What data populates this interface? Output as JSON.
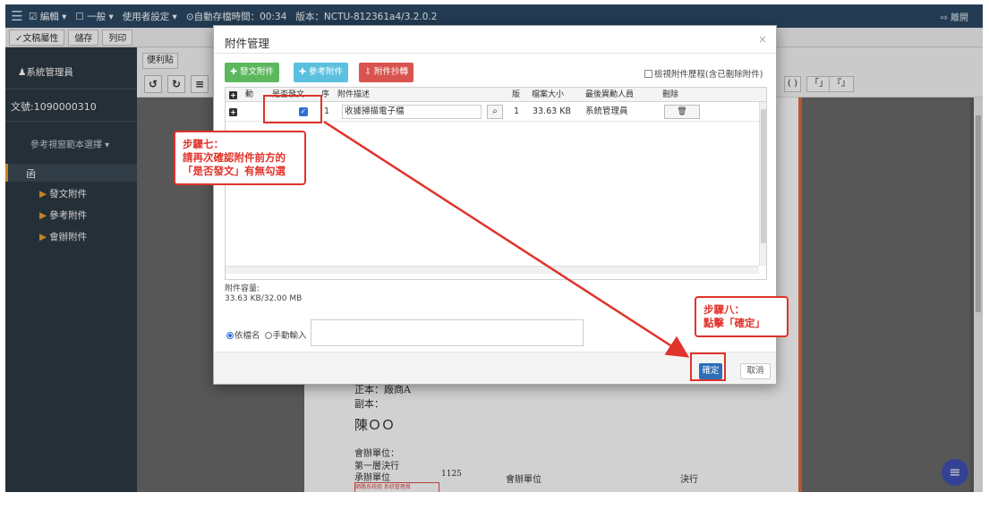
{
  "topbar": {
    "items": [
      "☑ 編輯 ▾",
      "☐ 一般 ▾",
      "使用者設定 ▾",
      "⊙自動存檔時間：00:34",
      "版本：NCTU-812361a4/3.2.0.2"
    ],
    "logout": "⇨ 離開"
  },
  "toolbar": {
    "buttons": [
      "✓文稿屬性",
      "儲存",
      "列印"
    ]
  },
  "sidebar": {
    "admin": "♟系統管理員",
    "doc_no": "文號:1090000310",
    "ref_select": "參考視窗範本選擇 ▾",
    "active": "函",
    "items": [
      "發文附件",
      "參考附件",
      "會辦附件"
    ]
  },
  "editor": {
    "note_btn": "便利貼",
    "brackets": [
      "( )",
      "「」",
      "『』"
    ]
  },
  "paper": {
    "main_to": "正本：廠商A",
    "cc": "副本：",
    "signer": "陳ＯＯ",
    "co_unit": "會辦單位：",
    "first_layer": "第一層決行",
    "host_unit": "承辦單位",
    "code": "1125",
    "col_co": "會辦單位",
    "col_exec": "決行",
    "stamp": "網路系統組 系統管理員"
  },
  "modal": {
    "title": "附件管理",
    "close": "×",
    "btn_add_issue": "✚ 發文附件",
    "btn_add_ref": "✚ 參考附件",
    "btn_copy": "⇩ 附件抄轉",
    "show_history": "檢視附件歷程(含已刪除附件)",
    "headers": [
      "動",
      "是否發文",
      "序",
      "附件描述",
      "版",
      "檔案大小",
      "最後異動人員",
      "刪除"
    ],
    "row": {
      "seq": "1",
      "desc": "收據掃描電子檔",
      "version": "1",
      "size": "33.63 KB",
      "user": "系統管理員"
    },
    "capacity_label": "附件容量:",
    "capacity_value": "33.63 KB/32.00 MB",
    "radio_by_file": "依檔名",
    "radio_manual": "手動輸入",
    "ok": "確定",
    "cancel": "取消"
  },
  "annotations": {
    "step7": [
      "步驟七：",
      "請再次確認附件前方的",
      "「是否發文」有無勾選"
    ],
    "step8": [
      "步驟八：",
      "點擊「確定」"
    ]
  },
  "colors": {
    "topbar": "#2b4a67",
    "sidebar": "#2e3a44",
    "highlight": "#e0332b",
    "primary": "#2c6fb7",
    "btn_green": "#5cb85c",
    "btn_blue": "#5bc0de",
    "btn_red": "#d9534f"
  }
}
